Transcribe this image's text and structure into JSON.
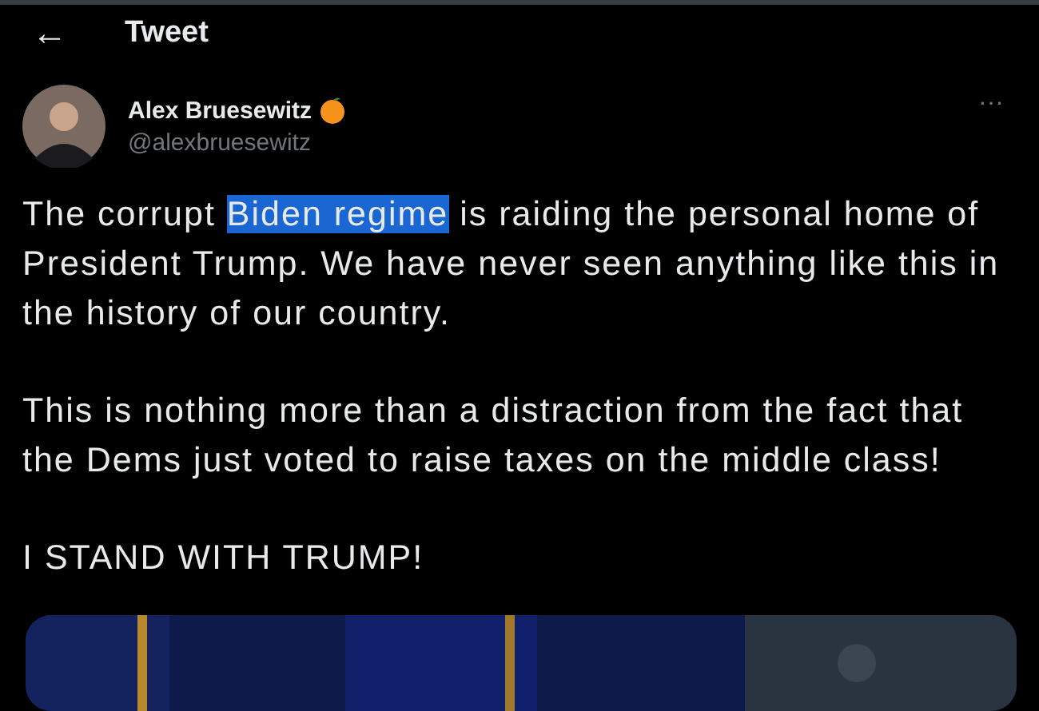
{
  "header": {
    "back": "←",
    "title": "Tweet"
  },
  "author": {
    "name": "Alex Bruesewitz",
    "handle": "@alexbruesewitz"
  },
  "more": "···",
  "paragraphs": [
    [
      {
        "text": "The corrupt ",
        "selected": false
      },
      {
        "text": "Biden regime",
        "selected": true
      },
      {
        "text": " is raiding the personal home of President Trump. We have never seen anything like this in the history of our country.",
        "selected": false
      }
    ],
    [
      {
        "text": "This is nothing more than a distraction from the fact that the Dems just voted to raise taxes on the middle class!",
        "selected": false
      }
    ],
    [
      {
        "text": "I STAND WITH TRUMP!",
        "selected": false
      }
    ]
  ]
}
